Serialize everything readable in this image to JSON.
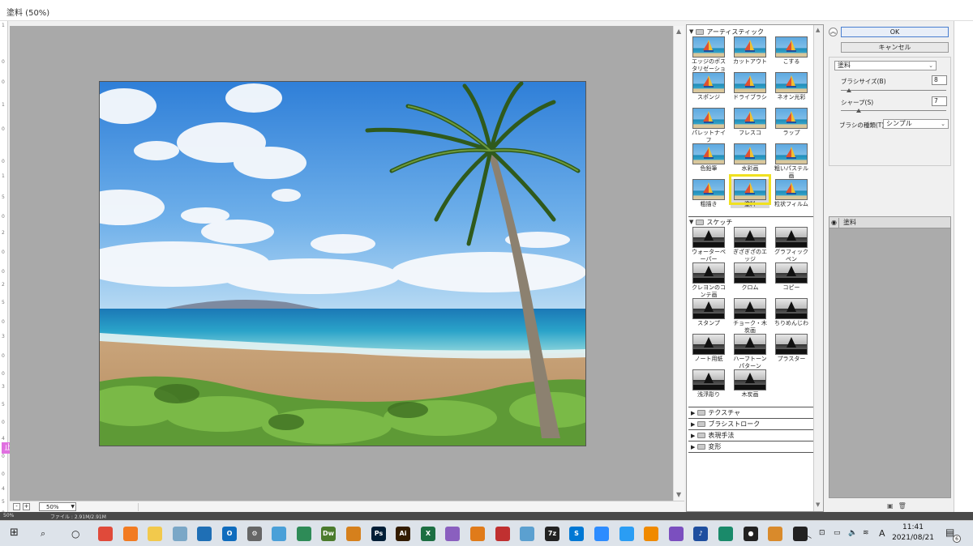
{
  "window": {
    "title": "塗料 (50%)"
  },
  "left_ruler": [
    "1",
    "0",
    "0",
    "1",
    "0",
    "0",
    "1",
    "5",
    "0",
    "2",
    "0",
    "0",
    "2",
    "5",
    "0",
    "3",
    "0",
    "0",
    "3",
    "5",
    "0",
    "4",
    "0",
    "0",
    "4",
    "5",
    "0",
    "5"
  ],
  "left_tag": "止",
  "preview": {
    "zoom_value": "50%",
    "minus_label": "-",
    "plus_label": "+"
  },
  "gallery": {
    "categories": [
      {
        "name": "アーティスティック",
        "expanded": true,
        "filters": [
          [
            "エッジのポスタリゼーション",
            "カットアウト",
            "こする"
          ],
          [
            "スポンジ",
            "ドライブラシ",
            "ネオン光彩"
          ],
          [
            "パレットナイフ",
            "フレスコ",
            "ラップ"
          ],
          [
            "色鉛筆",
            "水彩画",
            "粗いパステル画"
          ],
          [
            "粗描き",
            "塗料",
            "粒状フィルム"
          ]
        ]
      },
      {
        "name": "スケッチ",
        "expanded": true,
        "filters": [
          [
            "ウォーターペーパー",
            "ぎざぎざのエッジ",
            "グラフィックペン"
          ],
          [
            "クレヨンのコンテ画",
            "クロム",
            "コピー"
          ],
          [
            "スタンプ",
            "チョーク・木炭画",
            "ちりめんじわ"
          ],
          [
            "ノート用紙",
            "ハーフトーンパターン",
            "プラスター"
          ],
          [
            "浅浮彫り",
            "木炭画",
            ""
          ]
        ]
      }
    ],
    "selected": "塗料",
    "collapsed": [
      "テクスチャ",
      "ブラシストローク",
      "表現手法",
      "変形"
    ]
  },
  "controls": {
    "ok": "OK",
    "cancel": "キャンセル",
    "filter_select": "塗料",
    "params": [
      {
        "label": "ブラシサイズ(B)",
        "value": "8",
        "fraction": 0.08
      },
      {
        "label": "シャープ(S)",
        "value": "7",
        "fraction": 0.17
      }
    ],
    "brush_type_label": "ブラシの種類(T) :",
    "brush_type_value": "シンプル"
  },
  "layers": {
    "name": "塗料"
  },
  "status": {
    "zoom": "50%",
    "doc": "ファイル : 2.91M/2.91M"
  },
  "taskbar": {
    "apps": [
      {
        "name": "chrome",
        "label": "",
        "color": "#e04a3a"
      },
      {
        "name": "firefox",
        "label": "",
        "color": "#f27b22"
      },
      {
        "name": "explorer",
        "label": "",
        "color": "#f2c94c"
      },
      {
        "name": "app4",
        "label": "",
        "color": "#7aa7c7"
      },
      {
        "name": "photos",
        "label": "",
        "color": "#1f6fb5"
      },
      {
        "name": "outlook",
        "label": "O",
        "color": "#0f6cbd"
      },
      {
        "name": "settings",
        "label": "⚙",
        "color": "#666666"
      },
      {
        "name": "app8",
        "label": "",
        "color": "#4aa0d8"
      },
      {
        "name": "app9",
        "label": "",
        "color": "#2e8b57"
      },
      {
        "name": "dreamweaver",
        "label": "Dw",
        "color": "#4b7b2c"
      },
      {
        "name": "app11",
        "label": "",
        "color": "#d6801c"
      },
      {
        "name": "photoshop",
        "label": "Ps",
        "color": "#001e36"
      },
      {
        "name": "illustrator",
        "label": "Ai",
        "color": "#331c00"
      },
      {
        "name": "excel",
        "label": "X",
        "color": "#1d6f42"
      },
      {
        "name": "app15",
        "label": "",
        "color": "#8a5fbf"
      },
      {
        "name": "butterfly",
        "label": "",
        "color": "#e07b1a"
      },
      {
        "name": "app17",
        "label": "",
        "color": "#c03030"
      },
      {
        "name": "app18",
        "label": "",
        "color": "#5ba0d0"
      },
      {
        "name": "7zip",
        "label": "7z",
        "color": "#222222"
      },
      {
        "name": "skype",
        "label": "S",
        "color": "#0078d4"
      },
      {
        "name": "zoom",
        "label": "",
        "color": "#2d8cff"
      },
      {
        "name": "app22",
        "label": "",
        "color": "#2a9df4"
      },
      {
        "name": "vlc",
        "label": "",
        "color": "#f08a00"
      },
      {
        "name": "app24",
        "label": "",
        "color": "#7b4fbf"
      },
      {
        "name": "music",
        "label": "♪",
        "color": "#1f4f9f"
      },
      {
        "name": "app26",
        "label": "",
        "color": "#1a8a6a"
      },
      {
        "name": "record",
        "label": "●",
        "color": "#222222"
      },
      {
        "name": "app28",
        "label": "",
        "color": "#d98a2b"
      },
      {
        "name": "app29",
        "label": "",
        "color": "#222222"
      }
    ],
    "ime": "A",
    "time": "11:41",
    "date": "2021/08/21",
    "notif": "6"
  }
}
